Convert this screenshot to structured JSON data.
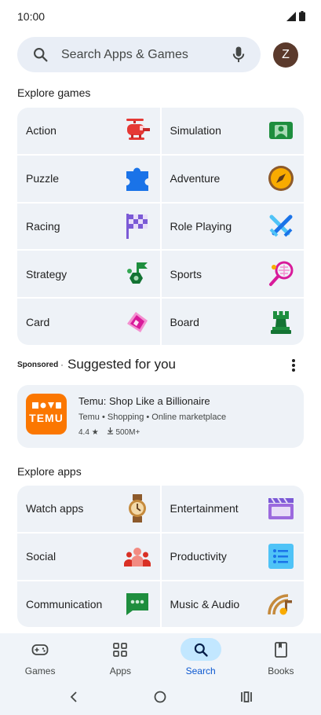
{
  "status_bar": {
    "time": "10:00"
  },
  "search": {
    "placeholder": "Search Apps & Games"
  },
  "profile": {
    "initial": "Z",
    "color": "#5b3a2c"
  },
  "explore_games": {
    "title": "Explore games",
    "items": [
      {
        "label": "Action",
        "icon": "helicopter-icon"
      },
      {
        "label": "Simulation",
        "icon": "simulation-icon"
      },
      {
        "label": "Puzzle",
        "icon": "puzzle-piece-icon"
      },
      {
        "label": "Adventure",
        "icon": "compass-icon"
      },
      {
        "label": "Racing",
        "icon": "checkered-flag-icon"
      },
      {
        "label": "Role Playing",
        "icon": "crossed-swords-icon"
      },
      {
        "label": "Strategy",
        "icon": "strategy-flag-icon"
      },
      {
        "label": "Sports",
        "icon": "tennis-racket-icon"
      },
      {
        "label": "Card",
        "icon": "card-icon"
      },
      {
        "label": "Board",
        "icon": "chess-rook-icon"
      }
    ]
  },
  "suggested": {
    "sponsored_label": "Sponsored",
    "separator": "·",
    "title": "Suggested for you",
    "app": {
      "name": "Temu: Shop Like a Billionaire",
      "meta": "Temu • Shopping • Online marketplace",
      "rating": "4.4",
      "downloads": "500M+",
      "logo_text": "TEMU",
      "logo_color": "#fb7701"
    }
  },
  "explore_apps": {
    "title": "Explore apps",
    "items": [
      {
        "label": "Watch apps",
        "icon": "watch-icon"
      },
      {
        "label": "Entertainment",
        "icon": "clapperboard-icon"
      },
      {
        "label": "Social",
        "icon": "people-icon"
      },
      {
        "label": "Productivity",
        "icon": "checklist-icon"
      },
      {
        "label": "Communication",
        "icon": "chat-bubble-icon"
      },
      {
        "label": "Music & Audio",
        "icon": "music-note-icon"
      }
    ]
  },
  "bottom_nav": {
    "items": [
      {
        "label": "Games",
        "icon": "gamepad-icon",
        "active": false
      },
      {
        "label": "Apps",
        "icon": "apps-grid-icon",
        "active": false
      },
      {
        "label": "Search",
        "icon": "search-icon",
        "active": true
      },
      {
        "label": "Books",
        "icon": "book-icon",
        "active": false
      }
    ]
  }
}
